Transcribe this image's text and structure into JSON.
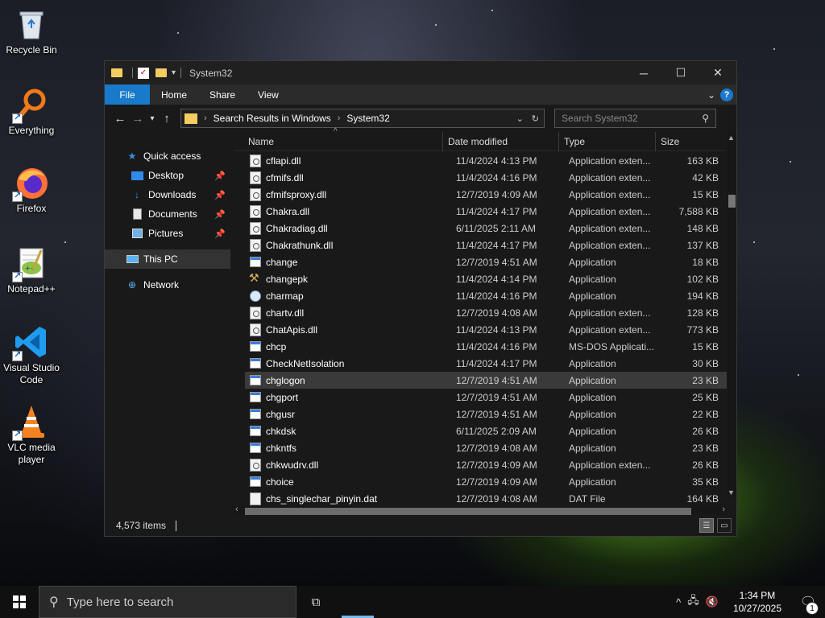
{
  "desktop": {
    "icons": [
      {
        "label": "Recycle Bin",
        "icon": "recycle-bin-icon"
      },
      {
        "label": "Everything",
        "icon": "everything-search-icon"
      },
      {
        "label": "Firefox",
        "icon": "firefox-icon"
      },
      {
        "label": "Notepad++",
        "icon": "notepad-plus-plus-icon"
      },
      {
        "label": "Visual Studio Code",
        "icon": "vscode-icon"
      },
      {
        "label": "VLC media player",
        "icon": "vlc-icon"
      }
    ]
  },
  "window": {
    "title": "System32",
    "ribbon": {
      "tabs": [
        "File",
        "Home",
        "Share",
        "View"
      ],
      "help": "?"
    },
    "address": {
      "crumbs": [
        "Search Results in Windows",
        "System32"
      ]
    },
    "search": {
      "placeholder": "Search System32"
    },
    "nav": [
      {
        "label": "Quick access",
        "icon": "star-icon",
        "pinned": false
      },
      {
        "label": "Desktop",
        "icon": "desktop-folder-icon",
        "pinned": true
      },
      {
        "label": "Downloads",
        "icon": "downloads-icon",
        "pinned": true
      },
      {
        "label": "Documents",
        "icon": "documents-icon",
        "pinned": true
      },
      {
        "label": "Pictures",
        "icon": "pictures-icon",
        "pinned": true
      },
      {
        "label": "This PC",
        "icon": "this-pc-icon",
        "pinned": false
      },
      {
        "label": "Network",
        "icon": "network-icon",
        "pinned": false
      }
    ],
    "columns": {
      "name": "Name",
      "date": "Date modified",
      "type": "Type",
      "size": "Size"
    },
    "files": [
      {
        "name": "cflapi.dll",
        "date": "11/4/2024 4:13 PM",
        "type": "Application exten...",
        "size": "163 KB",
        "icon": "dll"
      },
      {
        "name": "cfmifs.dll",
        "date": "11/4/2024 4:16 PM",
        "type": "Application exten...",
        "size": "42 KB",
        "icon": "dll"
      },
      {
        "name": "cfmifsproxy.dll",
        "date": "12/7/2019 4:09 AM",
        "type": "Application exten...",
        "size": "15 KB",
        "icon": "dll"
      },
      {
        "name": "Chakra.dll",
        "date": "11/4/2024 4:17 PM",
        "type": "Application exten...",
        "size": "7,588 KB",
        "icon": "dll"
      },
      {
        "name": "Chakradiag.dll",
        "date": "6/11/2025 2:11 AM",
        "type": "Application exten...",
        "size": "148 KB",
        "icon": "dll"
      },
      {
        "name": "Chakrathunk.dll",
        "date": "11/4/2024 4:17 PM",
        "type": "Application exten...",
        "size": "137 KB",
        "icon": "dll"
      },
      {
        "name": "change",
        "date": "12/7/2019 4:51 AM",
        "type": "Application",
        "size": "18 KB",
        "icon": "app"
      },
      {
        "name": "changepk",
        "date": "11/4/2024 4:14 PM",
        "type": "Application",
        "size": "102 KB",
        "icon": "tool"
      },
      {
        "name": "charmap",
        "date": "11/4/2024 4:16 PM",
        "type": "Application",
        "size": "194 KB",
        "icon": "charmap"
      },
      {
        "name": "chartv.dll",
        "date": "12/7/2019 4:08 AM",
        "type": "Application exten...",
        "size": "128 KB",
        "icon": "dll"
      },
      {
        "name": "ChatApis.dll",
        "date": "11/4/2024 4:13 PM",
        "type": "Application exten...",
        "size": "773 KB",
        "icon": "dll"
      },
      {
        "name": "chcp",
        "date": "11/4/2024 4:16 PM",
        "type": "MS-DOS Applicati...",
        "size": "15 KB",
        "icon": "app"
      },
      {
        "name": "CheckNetIsolation",
        "date": "11/4/2024 4:17 PM",
        "type": "Application",
        "size": "30 KB",
        "icon": "app"
      },
      {
        "name": "chglogon",
        "date": "12/7/2019 4:51 AM",
        "type": "Application",
        "size": "23 KB",
        "icon": "app",
        "selected": true
      },
      {
        "name": "chgport",
        "date": "12/7/2019 4:51 AM",
        "type": "Application",
        "size": "25 KB",
        "icon": "app"
      },
      {
        "name": "chgusr",
        "date": "12/7/2019 4:51 AM",
        "type": "Application",
        "size": "22 KB",
        "icon": "app"
      },
      {
        "name": "chkdsk",
        "date": "6/11/2025 2:09 AM",
        "type": "Application",
        "size": "26 KB",
        "icon": "app"
      },
      {
        "name": "chkntfs",
        "date": "12/7/2019 4:08 AM",
        "type": "Application",
        "size": "23 KB",
        "icon": "app"
      },
      {
        "name": "chkwudrv.dll",
        "date": "12/7/2019 4:09 AM",
        "type": "Application exten...",
        "size": "26 KB",
        "icon": "dll"
      },
      {
        "name": "choice",
        "date": "12/7/2019 4:09 AM",
        "type": "Application",
        "size": "35 KB",
        "icon": "app"
      },
      {
        "name": "chs_singlechar_pinyin.dat",
        "date": "12/7/2019 4:08 AM",
        "type": "DAT File",
        "size": "164 KB",
        "icon": "dat"
      }
    ],
    "status": {
      "count": "4,573 items"
    }
  },
  "taskbar": {
    "search_placeholder": "Type here to search",
    "time": "1:34 PM",
    "date": "10/27/2025",
    "notifications": "1"
  }
}
